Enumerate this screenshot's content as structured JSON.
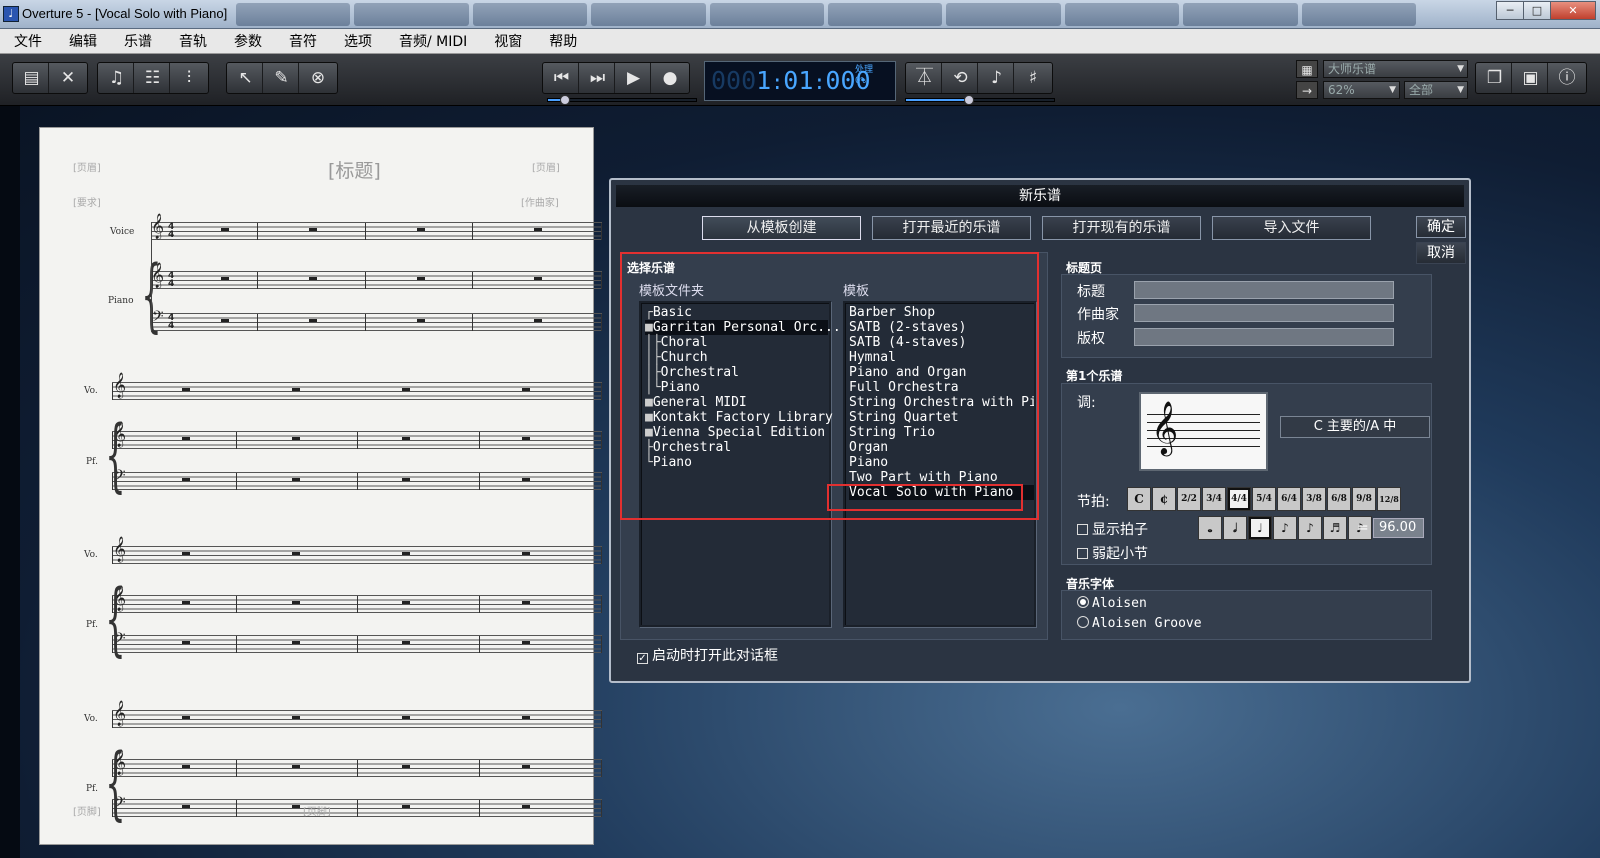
{
  "window": {
    "title": "Overture 5 - [Vocal Solo with Piano]",
    "buttons": {
      "minimize": "─",
      "maximize": "□",
      "close": "✕"
    }
  },
  "menu": [
    "文件",
    "编辑",
    "乐谱",
    "音轨",
    "参数",
    "音符",
    "选项",
    "音频/ MIDI",
    "视窗",
    "帮助"
  ],
  "toolbar": {
    "counter": {
      "lead": "000",
      "measure": "1",
      "beat": "01",
      "tick": "000",
      "extra": "1",
      "status": "处理",
      "percent": "0%"
    },
    "style_select": "大师乐谱",
    "zoom_select": "62%",
    "view_select": "全部"
  },
  "score": {
    "title": "[标题]",
    "header_left": "[页眉]",
    "header_right": "[页眉]",
    "request": "[要求]",
    "composer": "[作曲家]",
    "footer_left": "[页脚]",
    "footer_center": "[页脚]",
    "instruments": {
      "voice": "Voice",
      "piano": "Piano",
      "vo": "Vo.",
      "pf": "Pf."
    },
    "time_sig": "4"
  },
  "dialog": {
    "title": "新乐谱",
    "tabs": [
      "从模板创建",
      "打开最近的乐谱",
      "打开现有的乐谱",
      "导入文件"
    ],
    "active_tab": 0,
    "ok": "确定",
    "cancel": "取消",
    "select_score_label": "选择乐谱",
    "folders_header": "模板文件夹",
    "folders": [
      {
        "label": "Basic",
        "indent": 0,
        "expanded": false
      },
      {
        "label": "Garritan Personal Orc...",
        "indent": 0,
        "expanded": true,
        "selected": true
      },
      {
        "label": "Choral",
        "indent": 1
      },
      {
        "label": "Church",
        "indent": 1
      },
      {
        "label": "Orchestral",
        "indent": 1
      },
      {
        "label": "Piano",
        "indent": 1
      },
      {
        "label": "General MIDI",
        "indent": 0,
        "expanded": true
      },
      {
        "label": "Kontakt Factory Library",
        "indent": 0,
        "expanded": true
      },
      {
        "label": "Vienna Special Edition",
        "indent": 0,
        "expanded": true
      },
      {
        "label": "Orchestral",
        "indent": 1
      },
      {
        "label": "Piano",
        "indent": 1
      }
    ],
    "templates_header": "模板",
    "templates": [
      "Barber Shop",
      "SATB (2-staves)",
      "SATB (4-staves)",
      "Hymnal",
      "Piano and Organ",
      "Full Orchestra",
      "String Orchestra with Piano",
      "String Quartet",
      "String Trio",
      "Organ",
      "Piano",
      "Two Part with Piano",
      "Vocal Solo with Piano"
    ],
    "selected_template": "Vocal Solo with Piano",
    "title_page": {
      "label": "标题页",
      "fields": [
        {
          "label": "标题",
          "value": ""
        },
        {
          "label": "作曲家",
          "value": ""
        },
        {
          "label": "版权",
          "value": ""
        }
      ]
    },
    "first_staff": {
      "label": "第1个乐谱",
      "key_label": "调:",
      "key_value": "C 主要的/A 中",
      "meter_label": "节拍:",
      "meters": [
        "C",
        "¢",
        "2/2",
        "3/4",
        "4/4",
        "5/4",
        "6/4",
        "3/8",
        "6/8",
        "9/8",
        "12/8"
      ],
      "selected_meter": 4,
      "show_beat": "显示拍子",
      "pickup": "弱起小节",
      "tempo": "96.00",
      "note_values": [
        "𝅝",
        "𝅗𝅥",
        "♩",
        "♪",
        "♪",
        "♬",
        "♪"
      ],
      "selected_note": 2
    },
    "sound_font": {
      "label": "音乐字体",
      "options": [
        "Aloisen",
        "Aloisen Groove"
      ],
      "selected": 0
    },
    "startup_checkbox": "启动时打开此对话框",
    "startup_checked": true
  }
}
